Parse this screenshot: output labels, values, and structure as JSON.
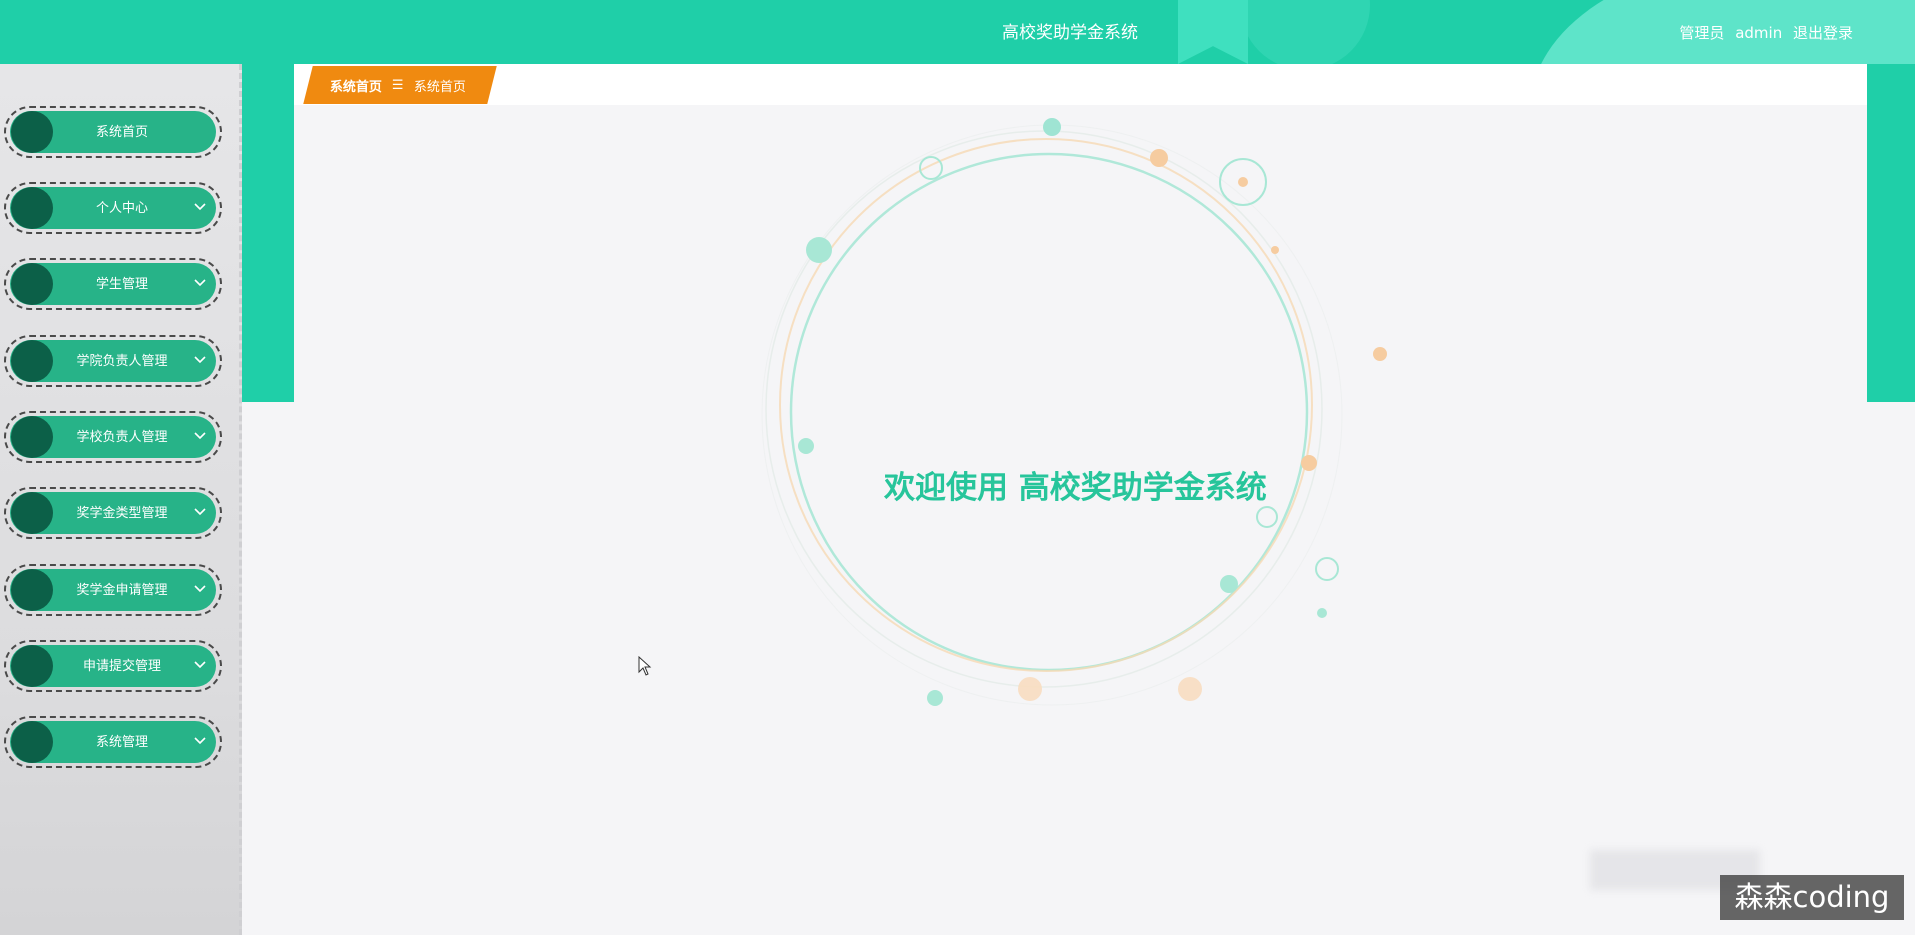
{
  "header": {
    "app_title": "高校奖助学金系统",
    "user_role": "管理员",
    "username": "admin",
    "logout_label": "退出登录"
  },
  "sidebar": {
    "items": [
      {
        "label": "系统首页",
        "has_submenu": false
      },
      {
        "label": "个人中心",
        "has_submenu": true
      },
      {
        "label": "学生管理",
        "has_submenu": true
      },
      {
        "label": "学院负责人管理",
        "has_submenu": true
      },
      {
        "label": "学校负责人管理",
        "has_submenu": true
      },
      {
        "label": "奖学金类型管理",
        "has_submenu": true
      },
      {
        "label": "奖学金申请管理",
        "has_submenu": true
      },
      {
        "label": "申请提交管理",
        "has_submenu": true
      },
      {
        "label": "系统管理",
        "has_submenu": true
      }
    ]
  },
  "breadcrumb": {
    "items": [
      "系统首页",
      "系统首页"
    ],
    "separator": "☰"
  },
  "welcome": {
    "message": "欢迎使用 高校奖助学金系统"
  },
  "watermark": {
    "text": "森森coding"
  },
  "colors": {
    "primary": "#1fcfa8",
    "menu_pill": "#27b388",
    "menu_dot": "#0c6048",
    "breadcrumb": "#f08a10",
    "welcome_text": "#27c59b"
  },
  "icons": {
    "menu_chevron": "chevron-down-icon",
    "breadcrumb_separator": "menu-lines-icon",
    "cursor": "mouse-pointer-icon"
  }
}
